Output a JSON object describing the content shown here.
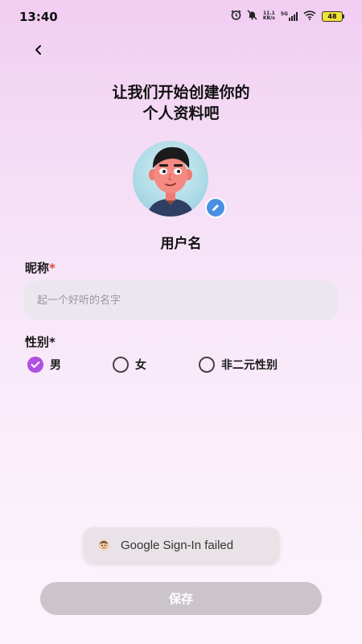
{
  "status_bar": {
    "time": "13:40",
    "net_speed_value": "11.1",
    "net_speed_unit": "KB/s",
    "network_type": "5G",
    "battery_level": "48",
    "icons": [
      "alarm-icon",
      "mute-icon",
      "signal-icon",
      "wifi-icon",
      "battery-icon"
    ]
  },
  "header": {
    "back_icon": "chevron-left-icon",
    "title_line1": "让我们开始创建你的",
    "title_line2": "个人资料吧"
  },
  "profile": {
    "avatar_icon": "avatar-cartoon",
    "edit_icon": "pencil-icon",
    "username": "用户名"
  },
  "form": {
    "nickname_label": "昵称",
    "nickname_required": "*",
    "nickname_placeholder": "起一个好听的名字",
    "nickname_value": "",
    "gender_label": "性别",
    "gender_required": "*",
    "gender_options": [
      {
        "label": "男",
        "selected": true
      },
      {
        "label": "女",
        "selected": false
      },
      {
        "label": "非二元性别",
        "selected": false
      }
    ]
  },
  "toast": {
    "icon": "app-icon",
    "text": "Google Sign-In failed"
  },
  "actions": {
    "save_label": "保存"
  },
  "colors": {
    "accent": "#b04fe0",
    "required": "#e0463c",
    "edit_badge": "#4a90e2",
    "save_disabled": "#cbc4cb"
  }
}
